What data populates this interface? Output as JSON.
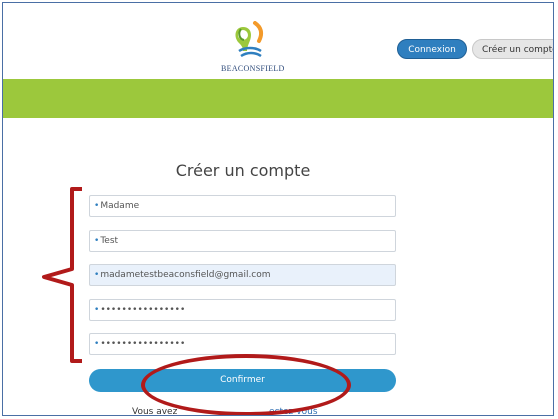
{
  "header": {
    "logo_text": "BEACONSFIELD",
    "login_button": "Connexion",
    "create_account_button": "Créer un compte"
  },
  "form": {
    "title": "Créer un compte",
    "fields": [
      {
        "value": "Madame",
        "highlighted": false
      },
      {
        "value": "Test",
        "highlighted": false
      },
      {
        "value": "madametestbeaconsfield@gmail.com",
        "highlighted": true
      },
      {
        "value": "••••••••••••••••",
        "highlighted": false
      },
      {
        "value": "••••••••••••••••",
        "highlighted": false
      }
    ],
    "required_marker": "•",
    "confirm_button": "Confirmer"
  },
  "footer": {
    "prefix_text": "Vous avez",
    "link_text": "ectez-vous"
  },
  "colors": {
    "primary": "#2f7fbf",
    "green_bar": "#9cc83c",
    "annotation": "#b11a1a"
  }
}
